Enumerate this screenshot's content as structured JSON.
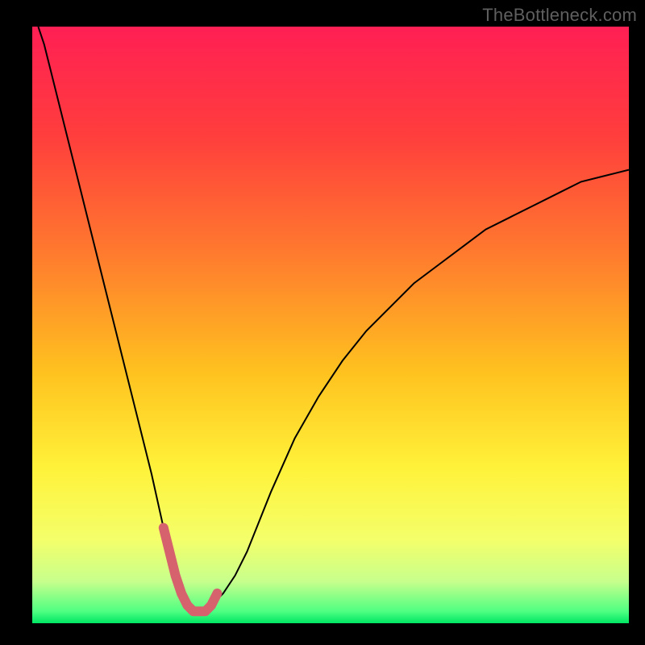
{
  "watermark": "TheBottleneck.com",
  "chart_data": {
    "type": "line",
    "title": "",
    "xlabel": "",
    "ylabel": "",
    "xlim": [
      0,
      100
    ],
    "ylim": [
      0,
      100
    ],
    "background_gradient": [
      {
        "stop": 0.0,
        "color": "#ff1f54"
      },
      {
        "stop": 0.18,
        "color": "#ff3d3d"
      },
      {
        "stop": 0.38,
        "color": "#ff7a2e"
      },
      {
        "stop": 0.58,
        "color": "#ffc21f"
      },
      {
        "stop": 0.74,
        "color": "#fff23a"
      },
      {
        "stop": 0.86,
        "color": "#f4ff6a"
      },
      {
        "stop": 0.93,
        "color": "#c7ff8c"
      },
      {
        "stop": 0.98,
        "color": "#4fff82"
      },
      {
        "stop": 1.0,
        "color": "#00e663"
      }
    ],
    "series": [
      {
        "name": "bottleneck-curve",
        "stroke": "#000000",
        "stroke_width": 2,
        "x": [
          1,
          2,
          3,
          4,
          5,
          6,
          8,
          10,
          12,
          14,
          16,
          18,
          20,
          22,
          23,
          24,
          25,
          26,
          27,
          28,
          29,
          30,
          32,
          34,
          36,
          38,
          40,
          44,
          48,
          52,
          56,
          60,
          64,
          68,
          72,
          76,
          80,
          84,
          88,
          92,
          96,
          100
        ],
        "y": [
          100,
          97,
          93,
          89,
          85,
          81,
          73,
          65,
          57,
          49,
          41,
          33,
          25,
          16,
          12,
          8,
          5,
          3,
          2,
          2,
          2,
          3,
          5,
          8,
          12,
          17,
          22,
          31,
          38,
          44,
          49,
          53,
          57,
          60,
          63,
          66,
          68,
          70,
          72,
          74,
          75,
          76
        ]
      }
    ],
    "highlight": {
      "name": "optimal-range",
      "stroke": "#d6626d",
      "stroke_width": 12,
      "x": [
        22,
        23,
        24,
        25,
        26,
        27,
        28,
        29,
        30,
        31
      ],
      "y": [
        16,
        12,
        8,
        5,
        3,
        2,
        2,
        2,
        3,
        5
      ]
    }
  }
}
